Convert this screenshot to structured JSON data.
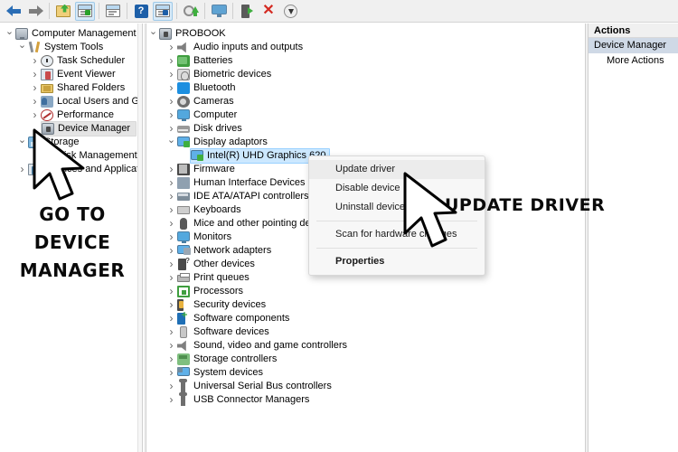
{
  "app": {
    "title": "Computer Management"
  },
  "toolbar": {
    "buttons": [
      {
        "name": "back-button",
        "icon": "back-arrow-icon",
        "label": "Back",
        "active": false
      },
      {
        "name": "forward-button",
        "icon": "forward-arrow-icon",
        "label": "Forward",
        "active": false
      },
      {
        "name": "export-list-button",
        "icon": "folder-export-icon",
        "label": "Export List",
        "active": false
      },
      {
        "name": "show-hide-console-tree-button",
        "icon": "console-tree-icon",
        "label": "Show/Hide Console Tree",
        "active": true
      },
      {
        "name": "properties-button",
        "icon": "properties-window-icon",
        "label": "Properties",
        "active": false
      },
      {
        "name": "help-button",
        "icon": "help-icon",
        "label": "Help",
        "active": false
      },
      {
        "name": "show-hide-action-pane-button",
        "icon": "action-pane-icon",
        "label": "Show/Hide Action Pane",
        "active": true
      },
      {
        "name": "update-driver-button",
        "icon": "update-driver-icon",
        "label": "Update Driver Software",
        "active": false
      },
      {
        "name": "scan-hardware-button",
        "icon": "scan-monitor-icon",
        "label": "Scan for hardware changes",
        "active": false
      },
      {
        "name": "enable-device-button",
        "icon": "enable-device-icon",
        "label": "Enable device",
        "active": false
      },
      {
        "name": "uninstall-device-button",
        "icon": "red-x-icon",
        "label": "Uninstall device",
        "active": false
      },
      {
        "name": "disable-device-button",
        "icon": "down-arrow-circle-icon",
        "label": "Disable device",
        "active": false
      }
    ]
  },
  "console_tree": {
    "items": [
      {
        "label": "Computer Management (Local",
        "indent": 0,
        "twisty": "open",
        "icon": "computer-icon",
        "selected": false
      },
      {
        "label": "System Tools",
        "indent": 1,
        "twisty": "open",
        "icon": "system-tools-icon",
        "selected": false
      },
      {
        "label": "Task Scheduler",
        "indent": 2,
        "twisty": "closed",
        "icon": "clock-icon",
        "selected": false
      },
      {
        "label": "Event Viewer",
        "indent": 2,
        "twisty": "closed",
        "icon": "event-viewer-icon",
        "selected": false
      },
      {
        "label": "Shared Folders",
        "indent": 2,
        "twisty": "closed",
        "icon": "shared-folders-icon",
        "selected": false
      },
      {
        "label": "Local Users and Groups",
        "indent": 2,
        "twisty": "closed",
        "icon": "users-icon",
        "selected": false
      },
      {
        "label": "Performance",
        "indent": 2,
        "twisty": "closed",
        "icon": "performance-icon",
        "selected": false
      },
      {
        "label": "Device Manager",
        "indent": 2,
        "twisty": "none",
        "icon": "device-manager-icon",
        "selected": true
      },
      {
        "label": "Storage",
        "indent": 1,
        "twisty": "open",
        "icon": "storage-icon",
        "selected": false
      },
      {
        "label": "Disk Management",
        "indent": 2,
        "twisty": "none",
        "icon": "disk-management-icon",
        "selected": false
      },
      {
        "label": "Services and Applications",
        "indent": 1,
        "twisty": "closed",
        "icon": "services-icon",
        "selected": false
      }
    ]
  },
  "device_tree": {
    "root": {
      "label": "PROBOOK",
      "twisty": "open",
      "icon": "computer-node-icon"
    },
    "items": [
      {
        "label": "Audio inputs and outputs",
        "twisty": "closed",
        "icon": "speaker-icon",
        "indent": 1,
        "selected": false
      },
      {
        "label": "Batteries",
        "twisty": "closed",
        "icon": "battery-icon",
        "indent": 1,
        "selected": false
      },
      {
        "label": "Biometric devices",
        "twisty": "closed",
        "icon": "fingerprint-icon",
        "indent": 1,
        "selected": false
      },
      {
        "label": "Bluetooth",
        "twisty": "closed",
        "icon": "bluetooth-icon",
        "indent": 1,
        "selected": false
      },
      {
        "label": "Cameras",
        "twisty": "closed",
        "icon": "camera-icon",
        "indent": 1,
        "selected": false
      },
      {
        "label": "Computer",
        "twisty": "closed",
        "icon": "monitor-icon",
        "indent": 1,
        "selected": false
      },
      {
        "label": "Disk drives",
        "twisty": "closed",
        "icon": "disk-drive-icon",
        "indent": 1,
        "selected": false
      },
      {
        "label": "Display adaptors",
        "twisty": "open",
        "icon": "display-adapter-icon",
        "indent": 1,
        "selected": false
      },
      {
        "label": "Intel(R) UHD Graphics 620",
        "twisty": "none",
        "icon": "display-adapter-icon",
        "indent": 2,
        "selected": true
      },
      {
        "label": "Firmware",
        "twisty": "closed",
        "icon": "firmware-icon",
        "indent": 1,
        "selected": false
      },
      {
        "label": "Human Interface Devices",
        "twisty": "closed",
        "icon": "hid-icon",
        "indent": 1,
        "selected": false
      },
      {
        "label": "IDE ATA/ATAPI controllers",
        "twisty": "closed",
        "icon": "ide-controller-icon",
        "indent": 1,
        "selected": false
      },
      {
        "label": "Keyboards",
        "twisty": "closed",
        "icon": "keyboard-icon",
        "indent": 1,
        "selected": false
      },
      {
        "label": "Mice and other pointing devices",
        "twisty": "closed",
        "icon": "mouse-icon",
        "indent": 1,
        "selected": false
      },
      {
        "label": "Monitors",
        "twisty": "closed",
        "icon": "monitor-icon",
        "indent": 1,
        "selected": false
      },
      {
        "label": "Network adapters",
        "twisty": "closed",
        "icon": "network-adapter-icon",
        "indent": 1,
        "selected": false
      },
      {
        "label": "Other devices",
        "twisty": "closed",
        "icon": "other-device-icon",
        "indent": 1,
        "selected": false
      },
      {
        "label": "Print queues",
        "twisty": "closed",
        "icon": "printer-icon",
        "indent": 1,
        "selected": false
      },
      {
        "label": "Processors",
        "twisty": "closed",
        "icon": "processor-icon",
        "indent": 1,
        "selected": false
      },
      {
        "label": "Security devices",
        "twisty": "closed",
        "icon": "security-device-icon",
        "indent": 1,
        "selected": false
      },
      {
        "label": "Software components",
        "twisty": "closed",
        "icon": "software-component-icon",
        "indent": 1,
        "selected": false
      },
      {
        "label": "Software devices",
        "twisty": "closed",
        "icon": "software-device-icon",
        "indent": 1,
        "selected": false
      },
      {
        "label": "Sound, video and game controllers",
        "twisty": "closed",
        "icon": "speaker-icon",
        "indent": 1,
        "selected": false
      },
      {
        "label": "Storage controllers",
        "twisty": "closed",
        "icon": "storage-controller-icon",
        "indent": 1,
        "selected": false
      },
      {
        "label": "System devices",
        "twisty": "closed",
        "icon": "system-device-icon",
        "indent": 1,
        "selected": false
      },
      {
        "label": "Universal Serial Bus controllers",
        "twisty": "closed",
        "icon": "usb-icon",
        "indent": 1,
        "selected": false
      },
      {
        "label": "USB Connector Managers",
        "twisty": "closed",
        "icon": "usb-icon",
        "indent": 1,
        "selected": false
      }
    ]
  },
  "context_menu": {
    "items": [
      {
        "label": "Update driver",
        "bold": false,
        "hovered": true,
        "separator_after": false
      },
      {
        "label": "Disable device",
        "bold": false,
        "hovered": false,
        "separator_after": false
      },
      {
        "label": "Uninstall device",
        "bold": false,
        "hovered": false,
        "separator_after": true
      },
      {
        "label": "Scan for hardware changes",
        "bold": false,
        "hovered": false,
        "separator_after": true
      },
      {
        "label": "Properties",
        "bold": true,
        "hovered": false,
        "separator_after": false
      }
    ]
  },
  "actions_pane": {
    "header": "Actions",
    "items": [
      {
        "label": "Device Manager",
        "selected": true,
        "sub": false
      },
      {
        "label": "More Actions",
        "selected": false,
        "sub": true
      }
    ]
  },
  "annotations": {
    "left": {
      "line1": "GO TO",
      "line2": "DEVICE",
      "line3": "MANAGER"
    },
    "right": {
      "text": "UPDATE DRIVER"
    }
  },
  "colors": {
    "selection_blue": "#cce8ff",
    "selection_gray": "#e4e4e4",
    "actions_selected": "#cfd9e6",
    "toolbar_bg": "#f0f0f0",
    "accent_blue": "#1d5fa8",
    "red": "#d42a22",
    "green": "#3fae3f"
  }
}
